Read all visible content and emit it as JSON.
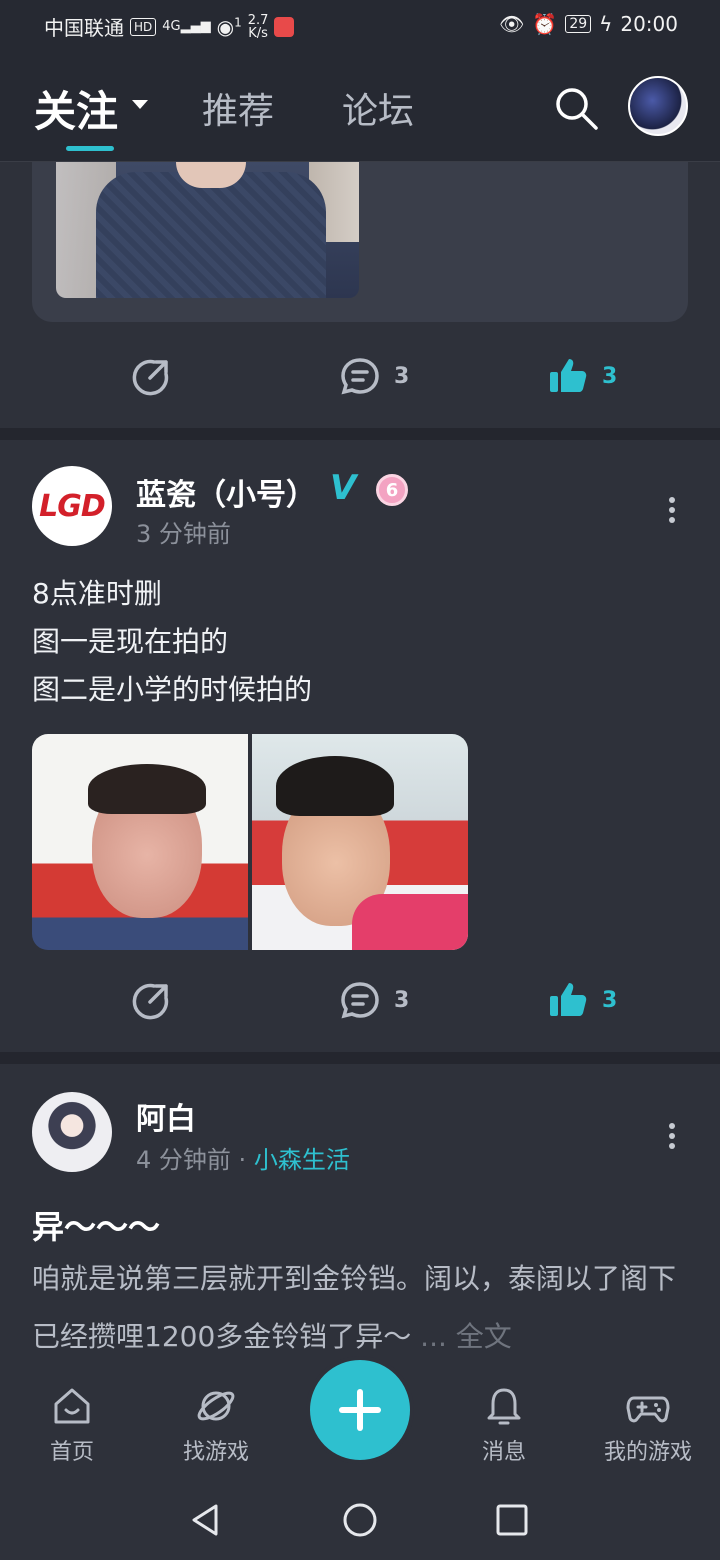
{
  "status_bar": {
    "carrier": "中国联通",
    "hd": "HD",
    "signal": "4G",
    "wifi_count": "1",
    "speed_value": "2.7",
    "speed_unit": "K/s",
    "battery": "29",
    "time": "20:00"
  },
  "top_nav": {
    "tabs": [
      {
        "label": "关注",
        "active": true
      },
      {
        "label": "推荐",
        "active": false
      },
      {
        "label": "论坛",
        "active": false
      }
    ],
    "search_icon": "search-icon",
    "accent": "#2ec0cf"
  },
  "feed": {
    "partial_post": {
      "comments": "3",
      "likes": "3"
    },
    "posts": [
      {
        "author": "蓝瓷（小号）",
        "verified": "V",
        "level": "6",
        "time": "3 分钟前",
        "lines": [
          "8点准时删",
          "图一是现在拍的",
          "图二是小学的时候拍的"
        ],
        "comments": "3",
        "likes": "3",
        "avatar_text": "LGD"
      },
      {
        "author": "阿白",
        "time": "4 分钟前",
        "separator": "·",
        "topic": "小森生活",
        "title": "异～～～",
        "body": "咱就是说第三层就开到金铃铛。阔以，泰阔以了阁下已经攒哩1200多金铃铛了异～",
        "more_label": "... 全文"
      }
    ]
  },
  "bottom_nav": {
    "items": [
      {
        "label": "首页",
        "icon": "home-icon"
      },
      {
        "label": "找游戏",
        "icon": "planet-icon"
      },
      {
        "label": "消息",
        "icon": "bell-icon"
      },
      {
        "label": "我的游戏",
        "icon": "gamepad-icon"
      }
    ],
    "fab_icon": "plus-icon"
  }
}
